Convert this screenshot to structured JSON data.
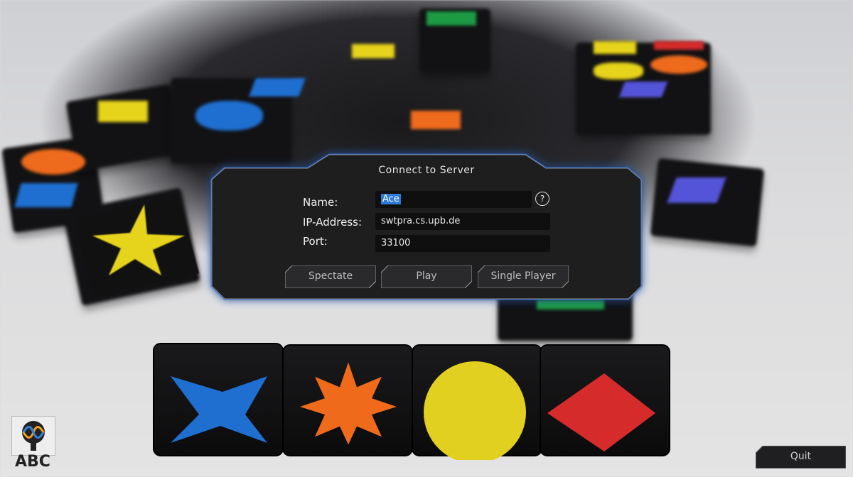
{
  "dialog": {
    "title": "Connect to Server",
    "name_label": "Name:",
    "name_value": "Ace",
    "help_symbol": "?",
    "ip_label": "IP-Address:",
    "ip_value": "swtpra.cs.upb.de",
    "port_label": "Port:",
    "port_value": "33100",
    "buttons": {
      "spectate": "Spectate",
      "play": "Play",
      "single_player": "Single Player"
    }
  },
  "logo": {
    "text": "ABC"
  },
  "quit_label": "Quit",
  "colors": {
    "accent_glow": "#2f6fd8",
    "dialog_bg": "#1c1c1d",
    "field_bg": "#0f0f10",
    "selection": "#2e7bd6",
    "tile_blue": "#1f6fd0",
    "tile_orange": "#f06a1c",
    "tile_yellow": "#e6d31b",
    "tile_red": "#d62b2b"
  }
}
